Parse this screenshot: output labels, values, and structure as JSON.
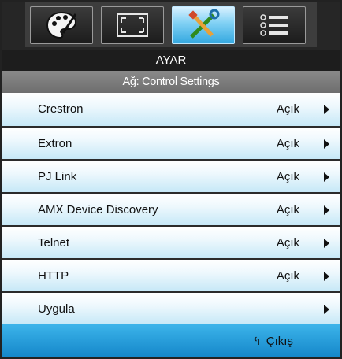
{
  "tabs": [
    {
      "icon": "palette-icon",
      "active": false
    },
    {
      "icon": "screen-icon",
      "active": false
    },
    {
      "icon": "tools-icon",
      "active": true
    },
    {
      "icon": "list-icon",
      "active": false
    }
  ],
  "header": {
    "title": "AYAR"
  },
  "subheader": {
    "title": "Ağ: Control Settings"
  },
  "menu": {
    "items": [
      {
        "label": "Crestron",
        "value": "Açık"
      },
      {
        "label": "Extron",
        "value": "Açık"
      },
      {
        "label": "PJ Link",
        "value": "Açık"
      },
      {
        "label": "AMX Device Discovery",
        "value": "Açık"
      },
      {
        "label": "Telnet",
        "value": "Açık"
      },
      {
        "label": "HTTP",
        "value": "Açık"
      },
      {
        "label": "Uygula",
        "value": ""
      }
    ]
  },
  "footer": {
    "exit_label": "Çıkış",
    "exit_icon": "back-arrow-icon"
  },
  "colors": {
    "accent": "#34a8e0",
    "row_tint": "#c6e8f7",
    "frame": "#2b2b2b"
  }
}
